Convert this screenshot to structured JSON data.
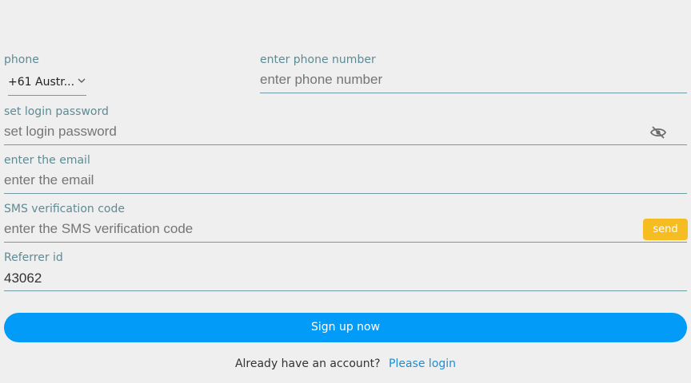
{
  "form": {
    "phone": {
      "country_label": "phone",
      "country_value": "+61 Austr...",
      "number_label": "enter phone number",
      "number_placeholder": "enter phone number"
    },
    "password": {
      "label": "set login password",
      "placeholder": "set login password",
      "toggle_icon": "eye-off-icon"
    },
    "email": {
      "label": "enter the email",
      "placeholder": "enter the email"
    },
    "sms": {
      "label": "SMS verification code",
      "placeholder": "enter the SMS verification code",
      "send_label": "send"
    },
    "referrer": {
      "label": "Referrer id",
      "value": "43062"
    }
  },
  "actions": {
    "signup_label": "Sign up now"
  },
  "footer": {
    "question": "Already have an account?",
    "login_link": "Please login"
  },
  "colors": {
    "background": "#efefef",
    "label": "#5f8a94",
    "primary": "#029cf8",
    "send": "#f5bd22",
    "link": "#1a8fd6"
  }
}
